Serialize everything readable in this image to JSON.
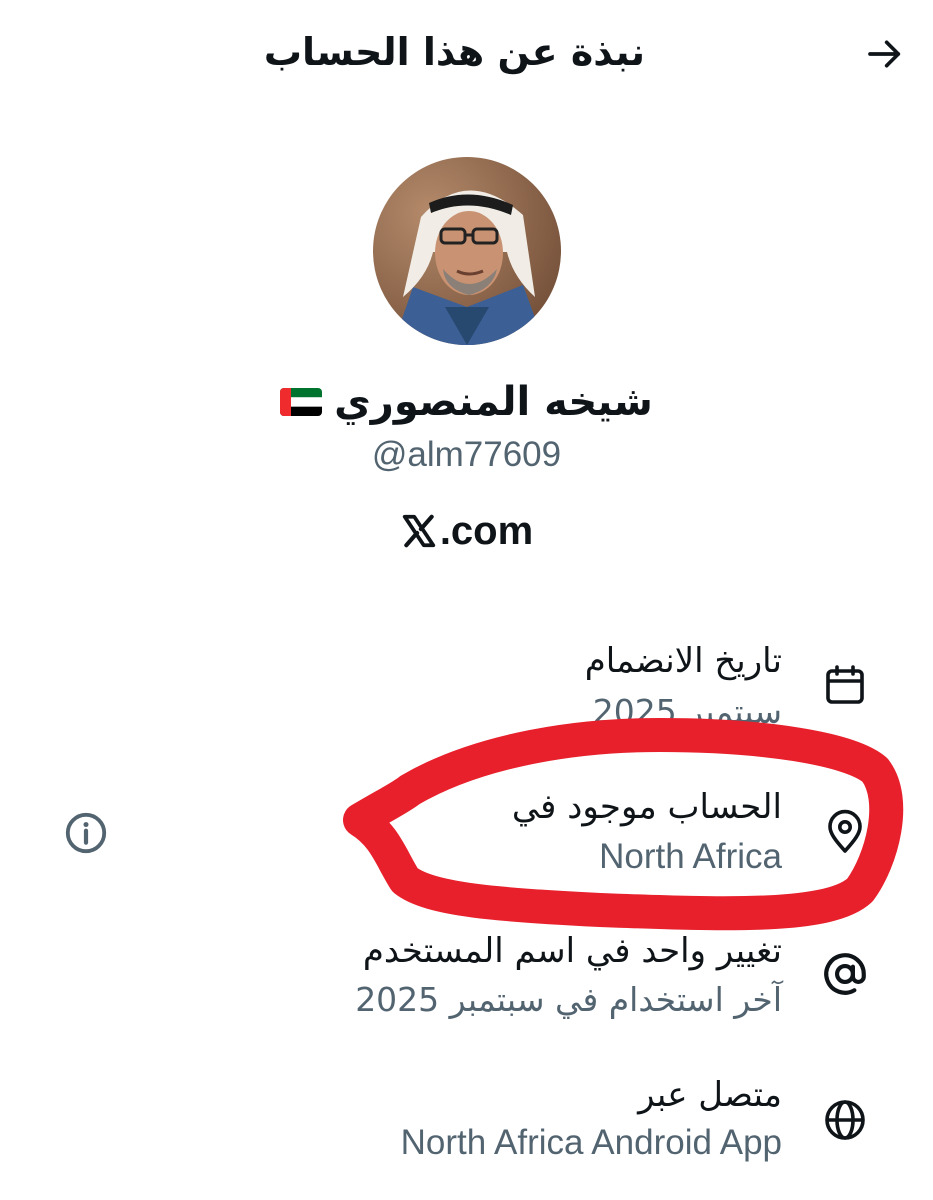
{
  "header": {
    "title": "نبذة عن هذا الحساب",
    "back_icon": "arrow-right-icon"
  },
  "profile": {
    "display_name": "شيخه المنصوري",
    "flag": "uae-flag",
    "handle": "@alm77609",
    "website": ".com",
    "website_logo": "x-logo-icon"
  },
  "details": {
    "joined": {
      "icon": "calendar-icon",
      "title": "تاريخ الانضمام",
      "value": "سبتمبر 2025"
    },
    "location": {
      "icon": "location-pin-icon",
      "title": "الحساب موجود في",
      "value": "North Africa",
      "info_icon": "info-icon"
    },
    "username_changes": {
      "icon": "at-sign-icon",
      "title": "تغيير واحد في اسم المستخدم",
      "value": "آخر استخدام في سبتمبر 2025"
    },
    "connected_via": {
      "icon": "globe-icon",
      "title": "متصل عبر",
      "value": "North Africa Android App"
    }
  },
  "colors": {
    "primary_text": "#0f1419",
    "secondary_text": "#536471",
    "annotation": "#e8202c"
  }
}
